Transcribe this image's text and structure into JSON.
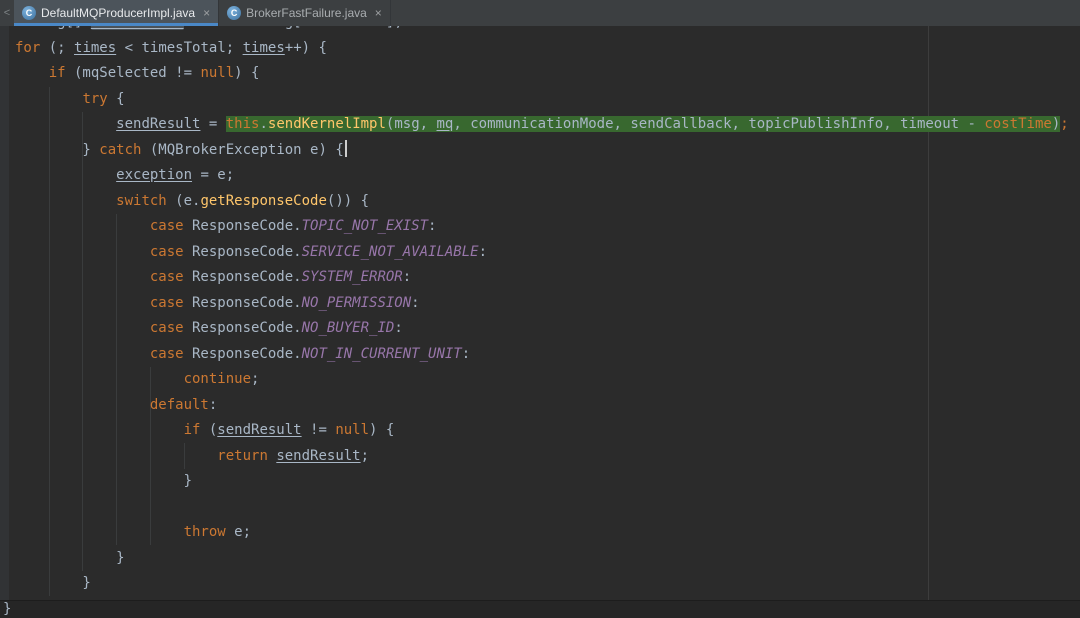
{
  "colors": {
    "keyword": "#CC7832",
    "method": "#FFC66B",
    "constant": "#9876AA",
    "text": "#A9B7C6",
    "green_highlight": "#38682F",
    "tab_underline": "#4A88C7",
    "class_icon_blue": "#3E719E",
    "identifier_box": "#4A5258",
    "editor_background": "#2B2B2B",
    "tab_bar_background": "#3C3F41"
  },
  "tab_bar": {
    "scroll_left_icon": "<",
    "tabs": [
      {
        "label": "DefaultMQProducerImpl.java",
        "icon_letter": "C",
        "close_icon": "×",
        "active": true
      },
      {
        "label": "BrokerFastFailure.java",
        "icon_letter": "C",
        "close_icon": "×",
        "active": false
      }
    ]
  },
  "editor": {
    "bottom_text": "}",
    "lines": [
      [
        [
          "d",
          "String[] "
        ],
        [
          "u sel",
          "brokersSent"
        ],
        [
          "d",
          " = "
        ],
        [
          "k",
          "new"
        ],
        [
          "d",
          " String[timesTotal];"
        ]
      ],
      [
        [
          "k",
          "for"
        ],
        [
          "d",
          " (; "
        ],
        [
          "u",
          "times"
        ],
        [
          "d",
          " < timesTotal; "
        ],
        [
          "u",
          "times"
        ],
        [
          "d",
          "++) {"
        ]
      ],
      [
        [
          "d",
          "    "
        ],
        [
          "k",
          "if"
        ],
        [
          "d",
          " (mqSelected != "
        ],
        [
          "k",
          "null"
        ],
        [
          "d",
          ") {"
        ]
      ],
      [
        [
          "d",
          "        "
        ],
        [
          "k",
          "try"
        ],
        [
          "d",
          " {"
        ]
      ],
      [
        [
          "d",
          "            "
        ],
        [
          "u",
          "sendResult"
        ],
        [
          "d",
          " = "
        ],
        [
          "k g",
          "this"
        ],
        [
          "d g",
          "."
        ],
        [
          "m g",
          "sendKernelImpl"
        ],
        [
          "d g",
          "(msg, "
        ],
        [
          "u g",
          "mq"
        ],
        [
          "d g",
          ", communicationMode, sendCallback, topicPublishInfo, timeout - "
        ],
        [
          "o g",
          "costTime"
        ],
        [
          "d g",
          ")"
        ],
        [
          "o",
          ";"
        ]
      ],
      [
        [
          "d",
          "        } "
        ],
        [
          "k",
          "catch"
        ],
        [
          "d",
          " (MQBrokerException e) {"
        ],
        [
          "caret",
          ""
        ]
      ],
      [
        [
          "d",
          "            "
        ],
        [
          "u",
          "exception"
        ],
        [
          "d",
          " = e;"
        ]
      ],
      [
        [
          "d",
          "            "
        ],
        [
          "k",
          "switch"
        ],
        [
          "d",
          " (e."
        ],
        [
          "m",
          "getResponseCode"
        ],
        [
          "d",
          "()) {"
        ]
      ],
      [
        [
          "d",
          "                "
        ],
        [
          "k",
          "case"
        ],
        [
          "d",
          " ResponseCode."
        ],
        [
          "c",
          "TOPIC_NOT_EXIST"
        ],
        [
          "d",
          ":"
        ]
      ],
      [
        [
          "d",
          "                "
        ],
        [
          "k",
          "case"
        ],
        [
          "d",
          " ResponseCode."
        ],
        [
          "c",
          "SERVICE_NOT_AVAILABLE"
        ],
        [
          "d",
          ":"
        ]
      ],
      [
        [
          "d",
          "                "
        ],
        [
          "k",
          "case"
        ],
        [
          "d",
          " ResponseCode."
        ],
        [
          "c",
          "SYSTEM_ERROR"
        ],
        [
          "d",
          ":"
        ]
      ],
      [
        [
          "d",
          "                "
        ],
        [
          "k",
          "case"
        ],
        [
          "d",
          " ResponseCode."
        ],
        [
          "c",
          "NO_PERMISSION"
        ],
        [
          "d",
          ":"
        ]
      ],
      [
        [
          "d",
          "                "
        ],
        [
          "k",
          "case"
        ],
        [
          "d",
          " ResponseCode."
        ],
        [
          "c",
          "NO_BUYER_ID"
        ],
        [
          "d",
          ":"
        ]
      ],
      [
        [
          "d",
          "                "
        ],
        [
          "k",
          "case"
        ],
        [
          "d",
          " ResponseCode."
        ],
        [
          "c",
          "NOT_IN_CURRENT_UNIT"
        ],
        [
          "d",
          ":"
        ]
      ],
      [
        [
          "d",
          "                    "
        ],
        [
          "k",
          "continue"
        ],
        [
          "d",
          ";"
        ]
      ],
      [
        [
          "d",
          "                "
        ],
        [
          "k",
          "default"
        ],
        [
          "d",
          ":"
        ]
      ],
      [
        [
          "d",
          "                    "
        ],
        [
          "k",
          "if"
        ],
        [
          "d",
          " ("
        ],
        [
          "u",
          "sendResult"
        ],
        [
          "d",
          " != "
        ],
        [
          "k",
          "null"
        ],
        [
          "d",
          ") {"
        ]
      ],
      [
        [
          "d",
          "                        "
        ],
        [
          "k",
          "return"
        ],
        [
          "d",
          " "
        ],
        [
          "u",
          "sendResult"
        ],
        [
          "d",
          ";"
        ]
      ],
      [
        [
          "d",
          "                    }"
        ]
      ],
      [],
      [
        [
          "d",
          "                    "
        ],
        [
          "k",
          "throw"
        ],
        [
          "d",
          " e;"
        ]
      ],
      [
        [
          "d",
          "            }"
        ]
      ],
      [
        [
          "d",
          "        }"
        ]
      ]
    ]
  }
}
